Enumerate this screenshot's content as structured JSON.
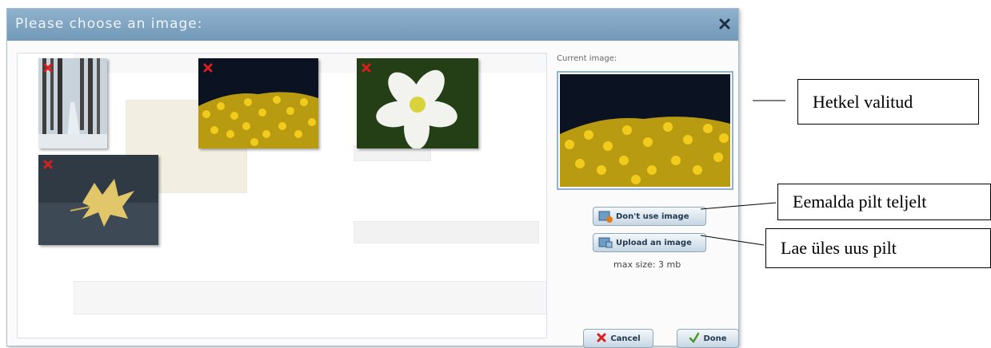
{
  "dialog": {
    "title": "Please choose an image:",
    "close_icon": "close-icon"
  },
  "gallery": {
    "images": [
      {
        "name": "winter-forest-thumbnail",
        "subject": "snowy forest path"
      },
      {
        "name": "yellow-flowers-thumbnail",
        "subject": "yellow flower field"
      },
      {
        "name": "white-flower-thumbnail",
        "subject": "white anemone flower"
      },
      {
        "name": "autumn-leaf-thumbnail",
        "subject": "yellow maple leaf"
      }
    ],
    "delete_icon": "delete-x-icon"
  },
  "current": {
    "label": "Current image:",
    "remove_label": "Don't use image",
    "upload_label": "Upload an image",
    "max_size": "max size: 3 mb"
  },
  "footer": {
    "cancel_label": "Cancel",
    "done_label": "Done"
  },
  "callouts": {
    "selected": "Hetkel valitud",
    "remove": "Eemalda pilt teljelt",
    "upload": "Lae üles uus pilt"
  },
  "colors": {
    "titlebar": "#7fa5c4",
    "accent": "#8fb2cf"
  }
}
